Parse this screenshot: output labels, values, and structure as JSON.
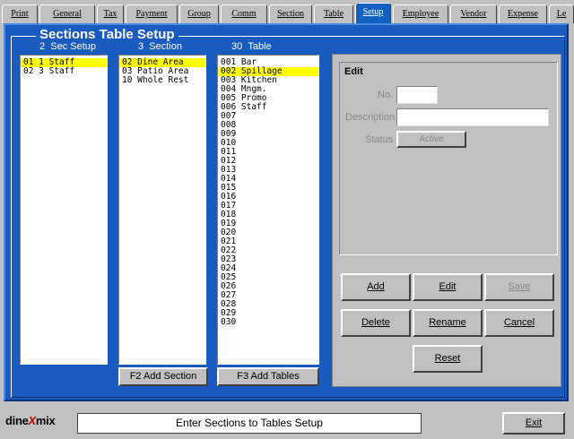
{
  "tabs": [
    {
      "label": "Print"
    },
    {
      "label": "General"
    },
    {
      "label": "Tax"
    },
    {
      "label": "Payment"
    },
    {
      "label": "Group"
    },
    {
      "label": "Comm"
    },
    {
      "label": "Section"
    },
    {
      "label": "Table"
    },
    {
      "label": "Setup"
    },
    {
      "label": "Employee"
    },
    {
      "label": "Vendor"
    },
    {
      "label": "Expense"
    },
    {
      "label": "Le"
    }
  ],
  "active_tab": "Setup",
  "page_title": "Sections Table Setup",
  "sec_setup": {
    "count": "2",
    "header": "Sec Setup",
    "items": [
      "01 1 Staff",
      "02 3 Staff"
    ]
  },
  "section": {
    "count": "3",
    "header": "Section",
    "items": [
      "02 Dine Area",
      "03 Patio Area",
      "10 Whole Rest"
    ]
  },
  "table": {
    "count": "30",
    "header": "Table",
    "items": [
      "001 Bar",
      "002 Spillage",
      "003 Kitchen",
      "004 Mngm.",
      "005 Promo",
      "006 Staff",
      "007",
      "008",
      "009",
      "010",
      "011",
      "012",
      "013",
      "014",
      "015",
      "016",
      "017",
      "018",
      "019",
      "020",
      "021",
      "022",
      "023",
      "024",
      "025",
      "026",
      "027",
      "028",
      "029",
      "030"
    ]
  },
  "buttons": {
    "add_section": "F2 Add Section",
    "add_tables": "F3 Add Tables",
    "add": "Add",
    "edit": "Edit",
    "save": "Save",
    "delete": "Delete",
    "rename": "Rename",
    "cancel": "Cancel",
    "reset": "Reset",
    "exit": "Exit"
  },
  "edit_panel": {
    "title": "Edit",
    "no_label": "No.",
    "no_value": "",
    "description_label": "Description",
    "description_value": "",
    "status_label": "Status",
    "status_value": "Active"
  },
  "footer": {
    "logo_pre": "dine",
    "logo_x": "X",
    "logo_post": "mix",
    "status_text": "Enter Sections to Tables Setup"
  },
  "colors": {
    "panel_blue": "#1a5bbf",
    "selection": "#ffff00"
  }
}
